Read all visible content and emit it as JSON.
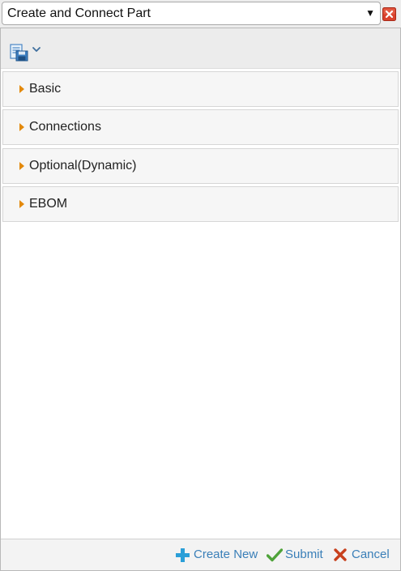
{
  "window": {
    "title": "Create and Connect Part",
    "dropdown_arrow": "▼",
    "close_icon": "close-icon"
  },
  "toolbar": {
    "save_icon": "save-icon",
    "menu_icon": "chevron-down-icon"
  },
  "sections": [
    {
      "label": "Basic",
      "state": "collapsed"
    },
    {
      "label": "Connections",
      "state": "collapsed"
    },
    {
      "label": "Optional(Dynamic)",
      "state": "collapsed"
    },
    {
      "label": "EBOM",
      "state": "collapsed"
    }
  ],
  "footer": {
    "create_new": "Create New",
    "submit": "Submit",
    "cancel": "Cancel"
  },
  "colors": {
    "link": "#3a7fb8",
    "section_arrow": "#e3890b",
    "close_red": "#d9412c",
    "submit_green": "#4fa33a",
    "cancel_red": "#c8401d",
    "create_blue": "#2b9fd8"
  }
}
